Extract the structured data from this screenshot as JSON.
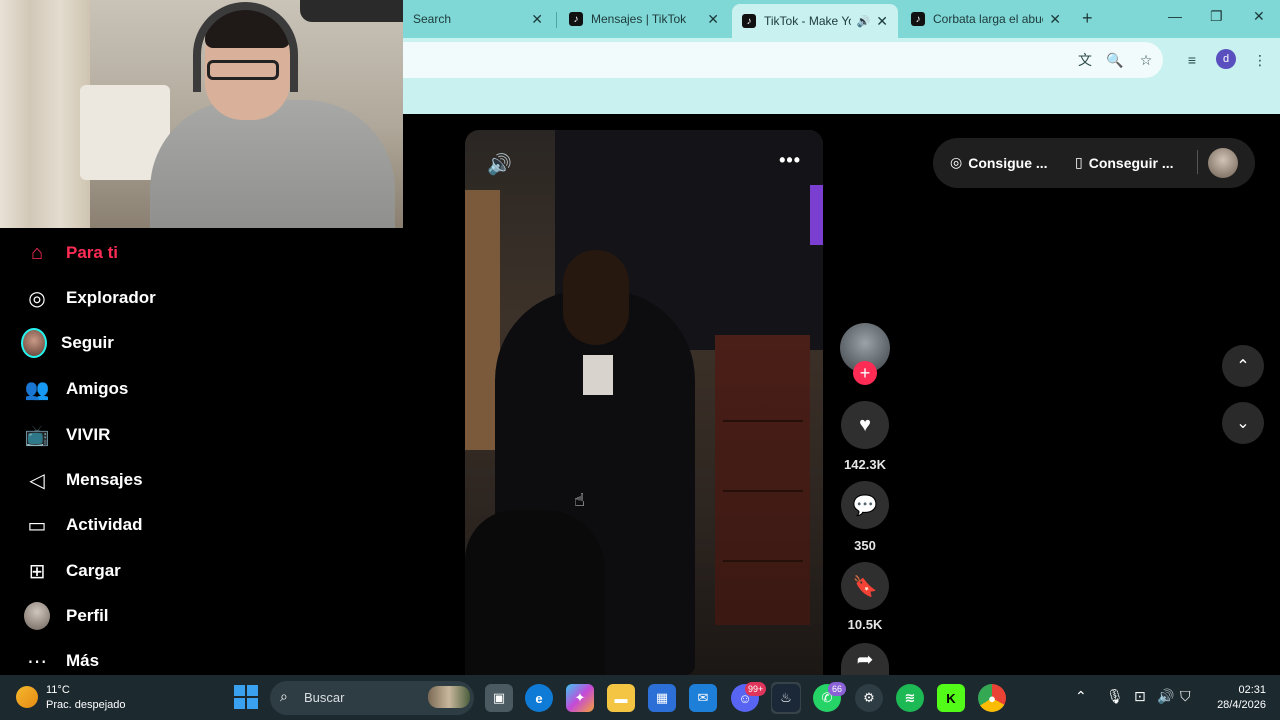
{
  "browser": {
    "tabs": [
      {
        "label": "Search",
        "icon": "none"
      },
      {
        "label": "Mensajes | TikTok",
        "icon": "tiktok-icon"
      },
      {
        "label": "TikTok - Make Yo",
        "icon": "tiktok-icon",
        "active": true
      },
      {
        "label": "Corbata larga el abue",
        "icon": "tiktok-icon"
      }
    ],
    "new_tab": "+",
    "profile_initial": "d"
  },
  "sidebar": {
    "items": [
      {
        "label": "Para ti",
        "icon": "home-icon",
        "active": true
      },
      {
        "label": "Explorador",
        "icon": "compass-icon"
      },
      {
        "label": "Seguir",
        "icon": "avatar"
      },
      {
        "label": "Amigos",
        "icon": "friends-icon"
      },
      {
        "label": "VIVIR",
        "icon": "live-tv-icon"
      },
      {
        "label": "Mensajes",
        "icon": "send-icon"
      },
      {
        "label": "Actividad",
        "icon": "activity-icon"
      },
      {
        "label": "Cargar",
        "icon": "upload-plus-icon"
      },
      {
        "label": "Perfil",
        "icon": "avatar"
      },
      {
        "label": "Más",
        "icon": "more-dots-icon"
      }
    ]
  },
  "top_actions": {
    "get_coins": "Consigue ...",
    "get_app": "Conseguir ..."
  },
  "video": {
    "likes": "142.3K",
    "comments": "350",
    "saves": "10.5K"
  },
  "taskbar": {
    "weather_temp": "11°C",
    "weather_desc": "Prac. despejado",
    "search_label": "Buscar",
    "copilot_badge": "99+",
    "whatsapp_badge": "66",
    "clock_time": "02:31",
    "clock_date": "28/4/2026"
  },
  "colors": {
    "tiktok_red": "#fe2c55",
    "chrome_teal": "#7fd7d6",
    "chrome_light": "#c8f1ef"
  }
}
